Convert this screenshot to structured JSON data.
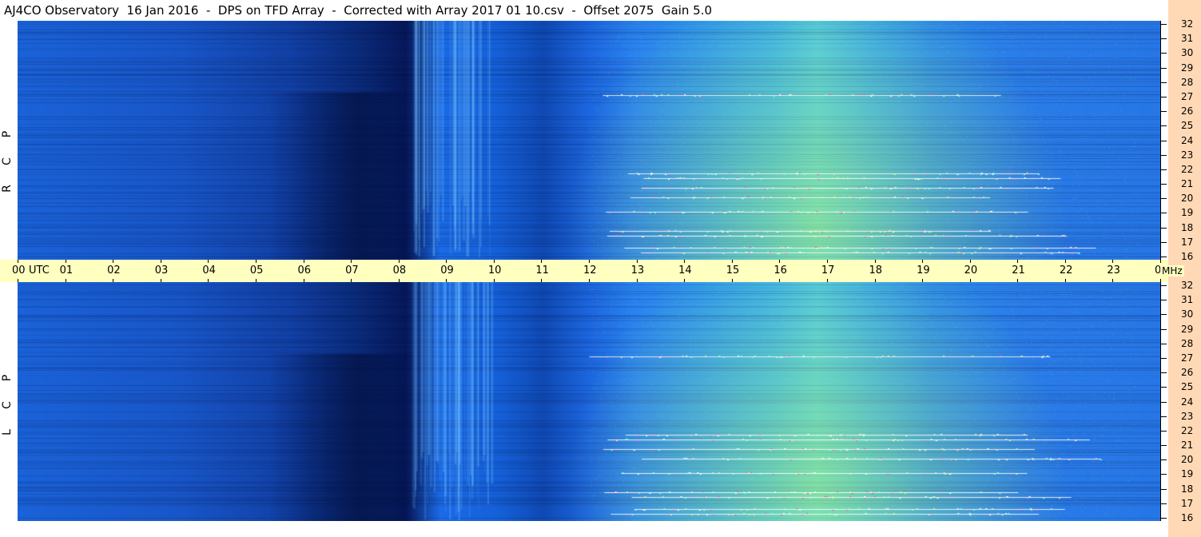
{
  "title": "AJ4CO Observatory  16 Jan 2016  -  DPS on TFD Array  -  Corrected with Array 2017 01 10.csv  -  Offset 2075  Gain 5.0",
  "panels": {
    "top": {
      "letters": [
        "P",
        "C",
        "R"
      ]
    },
    "bottom": {
      "letters": [
        "P",
        "C",
        "L"
      ]
    }
  },
  "time_axis": {
    "ticks": [
      "00",
      "01",
      "02",
      "03",
      "04",
      "05",
      "06",
      "07",
      "08",
      "09",
      "10",
      "11",
      "12",
      "13",
      "14",
      "15",
      "16",
      "17",
      "18",
      "19",
      "20",
      "21",
      "22",
      "23",
      "00"
    ],
    "utc_label": "UTC",
    "mhz_label": "MHz"
  },
  "freq_axis": {
    "ticks": [
      "32",
      "31",
      "30",
      "29",
      "28",
      "27",
      "26",
      "25",
      "24",
      "23",
      "22",
      "21",
      "20",
      "19",
      "18",
      "17",
      "16"
    ]
  },
  "colors": {
    "background_strip": "#ffd9b5",
    "time_band": "#ffffc0",
    "dark": "#06185a",
    "mid": "#1a62d8",
    "bright": "#4ec7e6",
    "hot": "#b6f57a"
  },
  "chart_data": {
    "type": "heatmap",
    "title": "AJ4CO Observatory  16 Jan 2016  -  DPS on TFD Array  -  Corrected with Array 2017 01 10.csv  -  Offset 2075  Gain 5.0",
    "xlabel": "UTC",
    "ylabel": "MHz",
    "xlim": [
      0,
      24
    ],
    "ylim": [
      16,
      32
    ],
    "series": [
      {
        "name": "RCP"
      },
      {
        "name": "LCP"
      }
    ]
  }
}
